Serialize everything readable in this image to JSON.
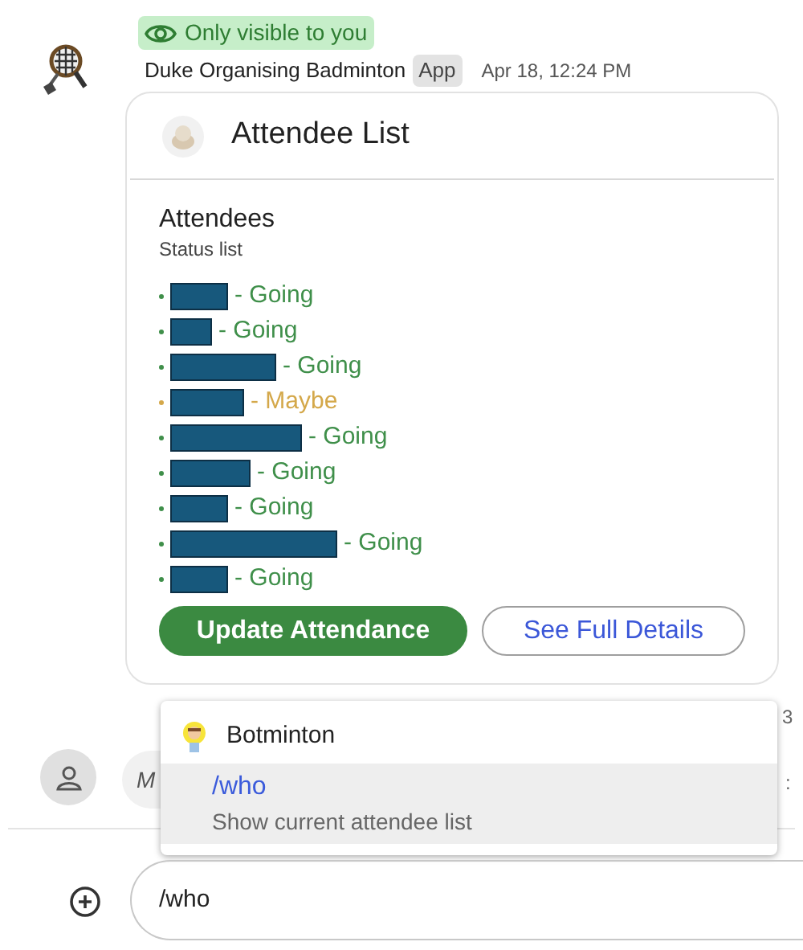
{
  "message": {
    "visibility_badge": "Only visible to you",
    "sender": "Duke Organising Badminton",
    "sender_tag": "App",
    "timestamp": "Apr 18, 12:24 PM",
    "card": {
      "title": "Attendee List",
      "section_title": "Attendees",
      "section_subtitle": "Status list",
      "attendees": [
        {
          "kind": "redacted",
          "status": "- Going",
          "color": "#3f8f4a"
        },
        {
          "kind": "redacted",
          "status": "- Going",
          "color": "#3f8f4a"
        },
        {
          "kind": "redacted",
          "status": "- Going",
          "color": "#3f8f4a"
        },
        {
          "kind": "redacted",
          "status": "- Maybe",
          "color": "#d4a84a"
        },
        {
          "kind": "redacted",
          "status": "- Going",
          "color": "#3f8f4a"
        },
        {
          "kind": "redacted",
          "status": "- Going",
          "color": "#3f8f4a"
        },
        {
          "kind": "redacted",
          "status": "- Going",
          "color": "#3f8f4a"
        },
        {
          "kind": "redacted",
          "status": "- Going",
          "color": "#3f8f4a"
        },
        {
          "kind": "redacted",
          "status": "- Going",
          "color": "#3f8f4a"
        }
      ],
      "buttons": [
        {
          "label": "Update Attendance",
          "kind": "filled"
        },
        {
          "label": "See Full Details",
          "kind": "outlined"
        }
      ]
    }
  },
  "background_message": {
    "bubble_text": "M",
    "edge_fragments": [
      "3",
      ":"
    ]
  },
  "command_popup": {
    "app_name": "Botminton",
    "commands": [
      {
        "command": "/who",
        "description": "Show current attendee list",
        "selected": true
      }
    ]
  },
  "composer": {
    "value": "/who"
  }
}
